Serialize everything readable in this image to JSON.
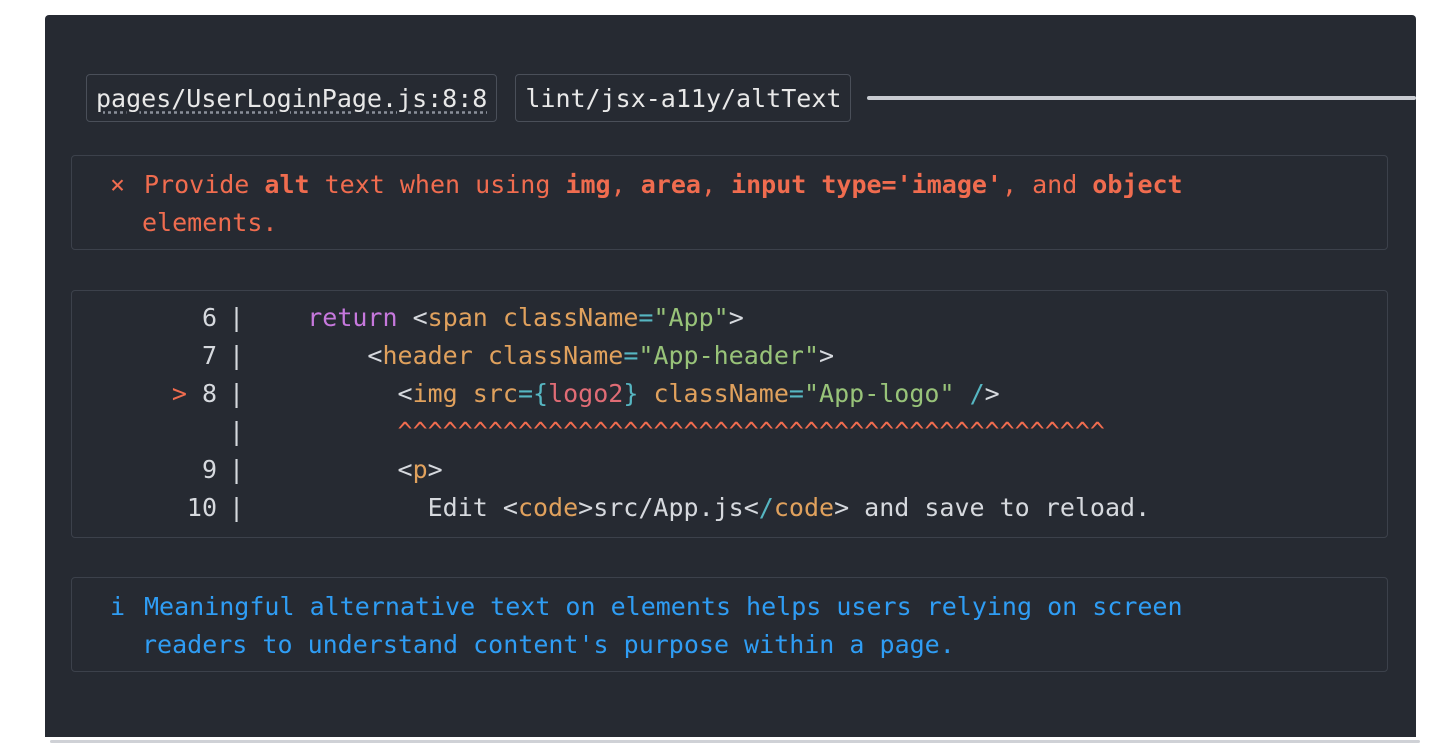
{
  "header": {
    "file_location": "pages/UserLoginPage.js:8:8",
    "rule_name": "lint/jsx-a11y/altText"
  },
  "error": {
    "icon": "×",
    "line1": {
      "t1": "Provide ",
      "b1": "alt",
      "t2": " text when using ",
      "b2": "img",
      "t3": ", ",
      "b3": "area",
      "t4": ", ",
      "b4": "input type='image'",
      "t5": ", and ",
      "b5": "object"
    },
    "line2": "elements."
  },
  "code": {
    "lines": [
      {
        "marker": "",
        "number": "6",
        "sep": "|",
        "tokens": [
          {
            "t": "  ",
            "c": "pun"
          },
          {
            "t": "return",
            "c": "kw"
          },
          {
            "t": " <",
            "c": "pun"
          },
          {
            "t": "span",
            "c": "tag"
          },
          {
            "t": " ",
            "c": "pun"
          },
          {
            "t": "className",
            "c": "attr"
          },
          {
            "t": "=",
            "c": "op"
          },
          {
            "t": "\"App\"",
            "c": "str"
          },
          {
            "t": ">",
            "c": "pun"
          }
        ]
      },
      {
        "marker": "",
        "number": "7",
        "sep": "|",
        "tokens": [
          {
            "t": "      <",
            "c": "pun"
          },
          {
            "t": "header",
            "c": "tag"
          },
          {
            "t": " ",
            "c": "pun"
          },
          {
            "t": "className",
            "c": "attr"
          },
          {
            "t": "=",
            "c": "op"
          },
          {
            "t": "\"App-header\"",
            "c": "str"
          },
          {
            "t": ">",
            "c": "pun"
          }
        ]
      },
      {
        "marker": ">",
        "number": "8",
        "sep": "|",
        "tokens": [
          {
            "t": "        <",
            "c": "pun"
          },
          {
            "t": "img",
            "c": "tag"
          },
          {
            "t": " ",
            "c": "pun"
          },
          {
            "t": "src",
            "c": "attr"
          },
          {
            "t": "={",
            "c": "op"
          },
          {
            "t": "logo2",
            "c": "var"
          },
          {
            "t": "}",
            "c": "op"
          },
          {
            "t": " ",
            "c": "pun"
          },
          {
            "t": "className",
            "c": "attr"
          },
          {
            "t": "=",
            "c": "op"
          },
          {
            "t": "\"App-logo\"",
            "c": "str"
          },
          {
            "t": " ",
            "c": "pun"
          },
          {
            "t": "/",
            "c": "op"
          },
          {
            "t": ">",
            "c": "pun"
          }
        ]
      },
      {
        "marker": "",
        "number": "",
        "sep": "|",
        "tokens": [
          {
            "t": "        ",
            "c": "pun"
          },
          {
            "t": "^^^^^^^^^^^^^^^^^^^^^^^^^^^^^^^^^^^^^^^^^^^^^^^",
            "c": "err"
          }
        ]
      },
      {
        "marker": "",
        "number": "9",
        "sep": "|",
        "tokens": [
          {
            "t": "        <",
            "c": "pun"
          },
          {
            "t": "p",
            "c": "tag"
          },
          {
            "t": ">",
            "c": "pun"
          }
        ]
      },
      {
        "marker": "",
        "number": "10",
        "sep": "|",
        "tokens": [
          {
            "t": "          Edit <",
            "c": "pun"
          },
          {
            "t": "code",
            "c": "tag"
          },
          {
            "t": ">src/App.js<",
            "c": "pun"
          },
          {
            "t": "/",
            "c": "op"
          },
          {
            "t": "code",
            "c": "tag"
          },
          {
            "t": "> and save to reload.",
            "c": "pun"
          }
        ]
      }
    ]
  },
  "info": {
    "icon": "i",
    "line1": "Meaningful alternative text on elements helps users relying on screen",
    "line2": "readers to understand content's purpose within a page."
  },
  "colors": {
    "background": "#262a32",
    "error": "#f06c4f",
    "info": "#2f9df4",
    "keyword": "#c678dd",
    "tag": "#e0a15d",
    "string": "#98c379",
    "operator": "#56b6c2",
    "variable": "#e06c75"
  }
}
